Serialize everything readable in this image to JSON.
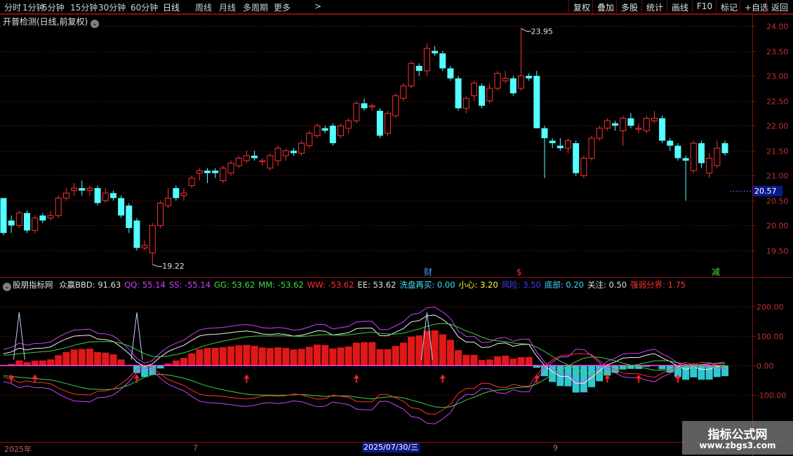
{
  "toolbar": {
    "periods": [
      "分时",
      "1分钟",
      "5分钟",
      "15分钟",
      "30分钟",
      "60分钟",
      "日线",
      "周线",
      "月线",
      "多周期",
      "更多"
    ],
    "more_arrow": ">",
    "active_period": "日线",
    "right_buttons": [
      "复权",
      "叠加",
      "多股",
      "统计",
      "画线",
      "F10",
      "标记",
      "+自选",
      "返回"
    ]
  },
  "main_chart": {
    "title": "开普检测(日线,前复权)",
    "price_tag": "20.57",
    "high_label": "23.95",
    "low_label": "19.22",
    "event_labels": [
      {
        "text": "财",
        "color": "#40a0ff"
      },
      {
        "text": "$",
        "color": "#ff3030"
      },
      {
        "text": "减",
        "color": "#40e040"
      }
    ]
  },
  "indicator": {
    "name": "股朋指标网",
    "items": [
      {
        "label": "众赢BBD: 91.63",
        "color": "#e0e0e0"
      },
      {
        "label": "QQ: 55.14",
        "color": "#d040ff"
      },
      {
        "label": "SS: -55.14",
        "color": "#d040ff"
      },
      {
        "label": "GG: 53.62",
        "color": "#40e040"
      },
      {
        "label": "MM: -53.62",
        "color": "#40e040"
      },
      {
        "label": "WW: -53.62",
        "color": "#ff3030"
      },
      {
        "label": "EE: 53.62",
        "color": "#e0e0e0"
      },
      {
        "label": "洗盘再买: 0.00",
        "color": "#40e0ff"
      },
      {
        "label": "小心: 3.20",
        "color": "#ffff40"
      },
      {
        "label": "风险: 3.50",
        "color": "#4040ff"
      },
      {
        "label": "底部: 0.20",
        "color": "#40e0ff"
      },
      {
        "label": "关注: 0.50",
        "color": "#e0e0e0"
      },
      {
        "label": "强弱分界: 1.75",
        "color": "#ff3030"
      }
    ]
  },
  "x_axis": {
    "labels": [
      "2025年",
      "7",
      "9"
    ],
    "cursor_date": "2025/07/30/三"
  },
  "watermark": {
    "main": "指标公式网",
    "sub": "www.zbgs3.com"
  },
  "colors": {
    "up": "#ff3030",
    "down": "#54ffff",
    "grid": "#8a1010",
    "axis_text": "#c03030"
  },
  "chart_data": [
    {
      "type": "candlestick",
      "y_ticks": [
        "24.00",
        "23.50",
        "23.00",
        "22.50",
        "22.00",
        "21.50",
        "21.00",
        "20.50",
        "20.00",
        "19.50"
      ],
      "y_range": [
        19.2,
        24.1
      ],
      "candles": [
        [
          20.55,
          19.85,
          20.55,
          19.8
        ],
        [
          20.1,
          20.0,
          20.2,
          19.85
        ],
        [
          20.0,
          20.25,
          20.3,
          19.95
        ],
        [
          20.25,
          19.9,
          20.3,
          19.85
        ],
        [
          19.9,
          20.15,
          20.2,
          19.85
        ],
        [
          20.2,
          20.1,
          20.25,
          20.05
        ],
        [
          20.15,
          20.2,
          20.3,
          20.1
        ],
        [
          20.2,
          20.55,
          20.6,
          20.15
        ],
        [
          20.55,
          20.65,
          20.75,
          20.5
        ],
        [
          20.7,
          20.75,
          20.85,
          20.6
        ],
        [
          20.75,
          20.7,
          20.9,
          20.6
        ],
        [
          20.7,
          20.75,
          20.8,
          20.6
        ],
        [
          20.75,
          20.45,
          20.8,
          20.4
        ],
        [
          20.5,
          20.65,
          20.75,
          20.45
        ],
        [
          20.65,
          20.55,
          20.7,
          20.5
        ],
        [
          20.55,
          20.2,
          20.6,
          20.15
        ],
        [
          20.4,
          19.95,
          20.45,
          19.85
        ],
        [
          20.1,
          19.55,
          20.15,
          19.5
        ],
        [
          19.55,
          19.6,
          19.7,
          19.5
        ],
        [
          19.45,
          20.0,
          20.05,
          19.22
        ],
        [
          20.0,
          20.45,
          20.5,
          19.95
        ],
        [
          20.4,
          20.55,
          20.75,
          20.35
        ],
        [
          20.75,
          20.55,
          20.8,
          20.5
        ],
        [
          20.6,
          20.65,
          20.75,
          20.5
        ],
        [
          20.8,
          20.95,
          21.0,
          20.75
        ],
        [
          21.05,
          21.1,
          21.15,
          20.9
        ],
        [
          21.1,
          21.05,
          21.15,
          20.85
        ],
        [
          21.1,
          21.05,
          21.15,
          20.95
        ],
        [
          20.9,
          21.15,
          21.2,
          20.85
        ],
        [
          21.05,
          21.25,
          21.3,
          21.0
        ],
        [
          21.2,
          21.35,
          21.4,
          21.15
        ],
        [
          21.3,
          21.4,
          21.5,
          21.25
        ],
        [
          21.4,
          21.35,
          21.5,
          21.3
        ],
        [
          21.3,
          21.3,
          21.35,
          21.2
        ],
        [
          21.15,
          21.4,
          21.45,
          21.1
        ],
        [
          21.3,
          21.55,
          21.6,
          21.2
        ],
        [
          21.4,
          21.5,
          21.55,
          21.3
        ],
        [
          21.5,
          21.45,
          21.55,
          21.4
        ],
        [
          21.45,
          21.65,
          21.7,
          21.4
        ],
        [
          21.6,
          21.85,
          21.9,
          21.55
        ],
        [
          21.8,
          22.0,
          22.05,
          21.75
        ],
        [
          21.95,
          21.9,
          22.0,
          21.85
        ],
        [
          22.0,
          21.65,
          22.05,
          21.6
        ],
        [
          21.8,
          22.0,
          22.05,
          21.75
        ],
        [
          21.95,
          22.1,
          22.15,
          21.85
        ],
        [
          22.1,
          22.45,
          22.5,
          22.05
        ],
        [
          22.45,
          22.35,
          22.55,
          22.3
        ],
        [
          22.4,
          22.4,
          22.45,
          22.3
        ],
        [
          22.3,
          21.8,
          22.35,
          21.75
        ],
        [
          21.85,
          22.25,
          22.3,
          21.8
        ],
        [
          22.2,
          22.6,
          22.65,
          22.15
        ],
        [
          22.55,
          22.8,
          22.85,
          22.5
        ],
        [
          22.8,
          23.25,
          23.3,
          22.75
        ],
        [
          23.2,
          23.1,
          23.25,
          23.0
        ],
        [
          23.1,
          23.55,
          23.65,
          23.0
        ],
        [
          23.5,
          23.45,
          23.6,
          23.4
        ],
        [
          23.45,
          23.15,
          23.5,
          23.1
        ],
        [
          23.15,
          22.95,
          23.2,
          22.9
        ],
        [
          22.95,
          22.35,
          23.0,
          22.3
        ],
        [
          22.35,
          22.55,
          22.6,
          22.25
        ],
        [
          22.6,
          22.85,
          22.9,
          22.5
        ],
        [
          22.8,
          22.4,
          22.85,
          22.35
        ],
        [
          22.5,
          22.75,
          22.85,
          22.45
        ],
        [
          22.75,
          23.05,
          23.1,
          22.7
        ],
        [
          22.9,
          22.95,
          23.1,
          22.85
        ],
        [
          22.95,
          22.65,
          23.0,
          22.6
        ],
        [
          22.75,
          23.0,
          23.95,
          22.7
        ],
        [
          23.0,
          22.95,
          23.05,
          22.9
        ],
        [
          23.0,
          21.95,
          23.1,
          21.95
        ],
        [
          21.95,
          21.75,
          22.0,
          20.95
        ],
        [
          21.7,
          21.65,
          21.75,
          21.55
        ],
        [
          21.6,
          21.55,
          21.75,
          21.5
        ],
        [
          21.55,
          21.7,
          21.75,
          21.45
        ],
        [
          21.65,
          21.05,
          21.7,
          21.0
        ],
        [
          21.0,
          21.35,
          21.4,
          20.95
        ],
        [
          21.35,
          21.75,
          21.8,
          21.3
        ],
        [
          21.75,
          21.95,
          22.0,
          21.7
        ],
        [
          21.95,
          22.1,
          22.15,
          21.9
        ],
        [
          22.05,
          22.0,
          22.1,
          21.9
        ],
        [
          21.9,
          22.15,
          22.2,
          21.6
        ],
        [
          22.15,
          22.0,
          22.25,
          21.95
        ],
        [
          21.95,
          21.95,
          22.05,
          21.85
        ],
        [
          21.9,
          22.15,
          22.2,
          21.85
        ],
        [
          22.1,
          22.15,
          22.3,
          22.05
        ],
        [
          22.15,
          21.7,
          22.2,
          21.65
        ],
        [
          21.7,
          21.6,
          21.75,
          21.5
        ],
        [
          21.6,
          21.35,
          21.65,
          21.3
        ],
        [
          21.35,
          21.3,
          21.4,
          20.5
        ],
        [
          21.1,
          21.65,
          21.7,
          21.05
        ],
        [
          21.65,
          21.25,
          21.7,
          21.15
        ],
        [
          21.05,
          21.35,
          21.45,
          20.95
        ],
        [
          21.2,
          21.55,
          21.7,
          21.15
        ],
        [
          21.65,
          21.45,
          21.7,
          21.4
        ]
      ]
    },
    {
      "type": "bar",
      "y_ticks": [
        "200.00",
        "100.00",
        "0.00",
        "-100.00"
      ],
      "y_range": [
        -260,
        260
      ]
    }
  ]
}
